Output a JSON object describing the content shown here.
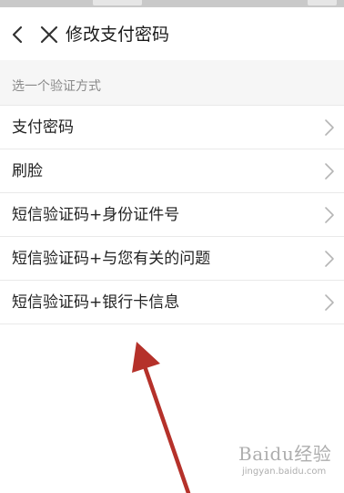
{
  "header": {
    "title": "修改支付密码",
    "back_icon": "chevron-left-icon",
    "close_icon": "close-icon"
  },
  "section": {
    "label": "选一个验证方式"
  },
  "options": [
    {
      "label": "支付密码"
    },
    {
      "label": "刷脸"
    },
    {
      "label": "短信验证码+身份证件号"
    },
    {
      "label": "短信验证码+与您有关的问题"
    },
    {
      "label": "短信验证码+银行卡信息"
    }
  ],
  "watermark": {
    "brand": "Baidu经验",
    "url": "jingyan.baidu.com"
  },
  "colors": {
    "background": "#ffffff",
    "section_background": "#f6f6f6",
    "divider": "#e9e9e9",
    "chevron": "#b5b5b5",
    "annotation_arrow": "#b5312a"
  }
}
